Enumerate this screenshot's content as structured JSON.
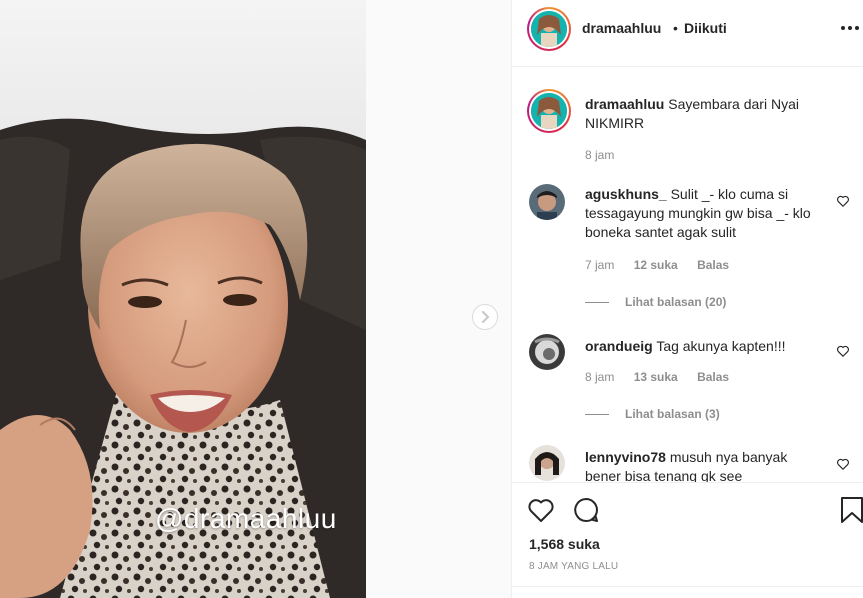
{
  "media": {
    "watermark": "@dramaahluu"
  },
  "header": {
    "username": "dramaahluu",
    "separator": "•",
    "follow_status": "Diikuti"
  },
  "caption": {
    "username": "dramaahluu",
    "text": "Sayembara dari Nyai NIKMIRR",
    "time": "8 jam"
  },
  "comments": [
    {
      "username": "aguskhuns_",
      "text": "Sulit _- klo cuma si tessagayung mungkin gw bisa _- klo boneka santet agak sulit",
      "time": "7 jam",
      "likes": "12 suka",
      "reply": "Balas",
      "view_replies": "Lihat balasan (20)"
    },
    {
      "username": "orandueig",
      "text": "Tag akunya kapten!!!",
      "time": "8 jam",
      "likes": "13 suka",
      "reply": "Balas",
      "view_replies": "Lihat balasan (3)"
    },
    {
      "username": "lennyvino78",
      "text": "musuh nya banyak bener bisa tenang gk see"
    }
  ],
  "footer": {
    "likes": "1,568 suka",
    "timestamp": "8 JAM YANG LALU"
  },
  "colors": {
    "text": "#262626",
    "secondary": "#8e8e8e",
    "border": "#efefef"
  }
}
